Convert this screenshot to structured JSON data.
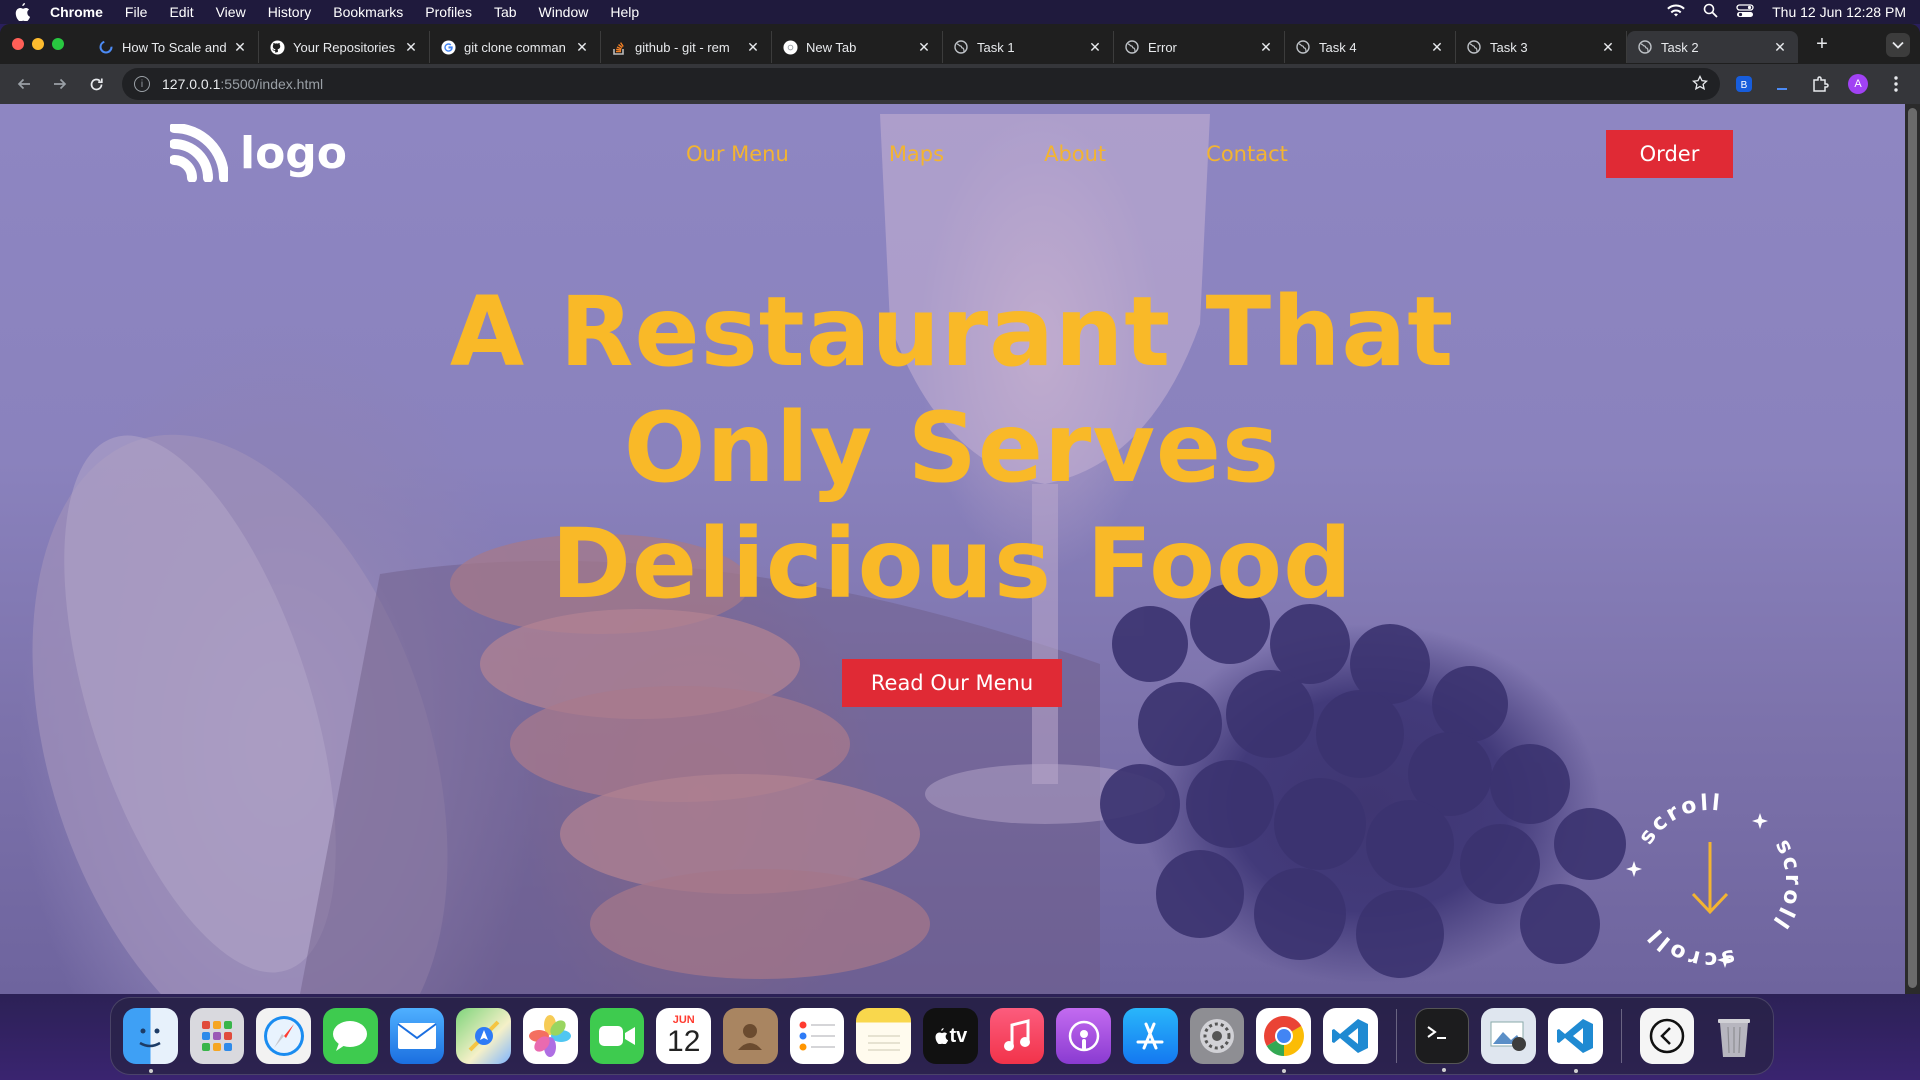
{
  "menubar": {
    "app_name": "Chrome",
    "items": [
      "File",
      "Edit",
      "View",
      "History",
      "Bookmarks",
      "Profiles",
      "Tab",
      "Window",
      "Help"
    ],
    "clock": "Thu 12 Jun  12:28 PM"
  },
  "browser": {
    "tabs": [
      {
        "title": "How To Scale and",
        "icon": "loading-icon"
      },
      {
        "title": "Your Repositories",
        "icon": "github-icon"
      },
      {
        "title": "git clone comman",
        "icon": "google-icon"
      },
      {
        "title": "github - git - rem",
        "icon": "stackoverflow-icon"
      },
      {
        "title": "New Tab",
        "icon": "chrome-icon"
      },
      {
        "title": "Task 1",
        "icon": "globe-icon"
      },
      {
        "title": "Error",
        "icon": "globe-icon"
      },
      {
        "title": "Task 4",
        "icon": "globe-icon"
      },
      {
        "title": "Task 3",
        "icon": "globe-icon"
      },
      {
        "title": "Task 2",
        "icon": "globe-icon",
        "active": true
      }
    ],
    "new_tab_label": "+",
    "url_host": "127.0.0.1",
    "url_path": ":5500/index.html",
    "profile_initial": "A"
  },
  "page": {
    "logo_text": "logo",
    "nav": [
      "Our Menu",
      "Maps",
      "About",
      "Contact"
    ],
    "order_label": "Order",
    "hero_line1": "A Restaurant That",
    "hero_line2": "Only Serves",
    "hero_line3": "Delicious Food",
    "hero_button": "Read Our Menu",
    "scroll_label": "scroll",
    "colors": {
      "accent_yellow": "#f9b928",
      "button_red": "#e02a35",
      "overlay_purple": "#8a82bd"
    }
  },
  "dock": {
    "calendar_month": "JUN",
    "calendar_day": "12",
    "tv_label": "tv",
    "apps": [
      "Finder",
      "Launchpad",
      "Safari",
      "Messages",
      "Mail",
      "Maps",
      "Photos",
      "FaceTime",
      "Calendar",
      "Contacts",
      "Reminders",
      "Notes",
      "TV",
      "Music",
      "Podcasts",
      "App Store",
      "System Settings",
      "Chrome",
      "VS Code",
      "Terminal",
      "Preview",
      "VS Code",
      "Back",
      "Trash"
    ]
  }
}
